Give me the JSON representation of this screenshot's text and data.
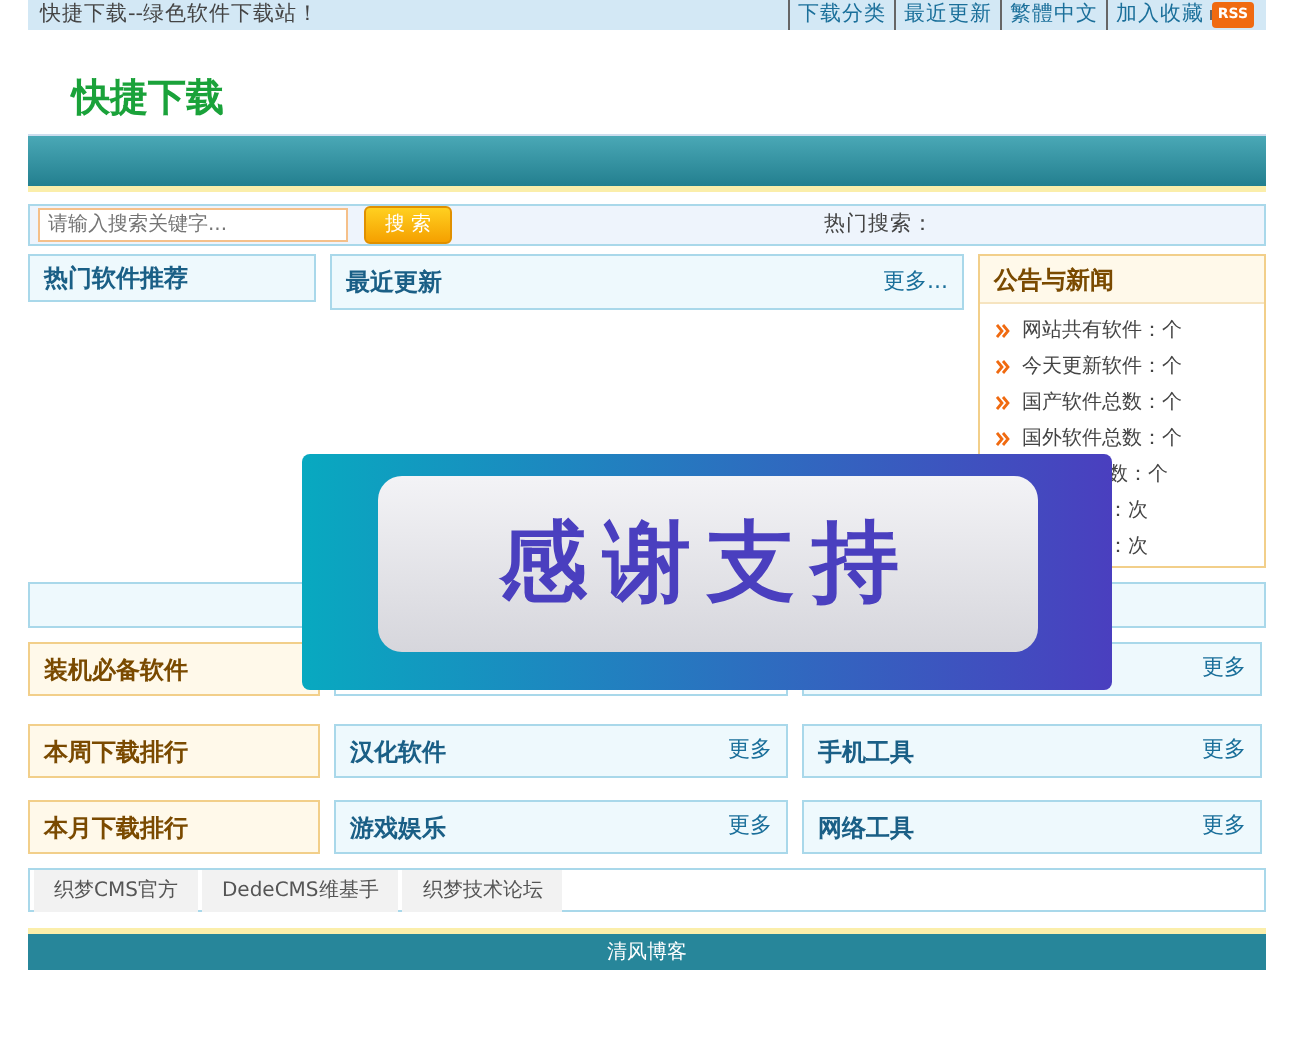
{
  "top_bar": {
    "site_slogan": "快捷下载--绿色软件下载站！",
    "links": [
      "下载分类",
      "最近更新",
      "繁體中文",
      "加入收藏"
    ],
    "rss_badge": "RSS"
  },
  "logo": "快捷下载",
  "search": {
    "placeholder": "请输入搜索关键字...",
    "button": "搜 索",
    "hot_label": "热门搜索："
  },
  "row_1": {
    "hot_panel": {
      "title": "热门软件推荐"
    },
    "recent_panel": {
      "title": "最近更新",
      "more": "更多..."
    },
    "news_panel": {
      "title": "公告与新闻",
      "items": [
        {
          "kind": "full",
          "text": "网站共有软件：个"
        },
        {
          "kind": "full",
          "text": "今天更新软件：个"
        },
        {
          "kind": "full",
          "text": "国产软件总数：个"
        },
        {
          "kind": "full",
          "text": "国外软件总数：个"
        },
        {
          "kind": "clipped",
          "text": "数：个"
        },
        {
          "kind": "clipped",
          "text": "：次"
        },
        {
          "kind": "clipped",
          "text": "：次"
        }
      ]
    }
  },
  "category_rows": [
    {
      "rank_title": "装机必备软件",
      "panels": [
        {
          "kind": "blank"
        },
        {
          "kind": "titled",
          "more": "更多"
        }
      ]
    },
    {
      "rank_title": "本周下载排行",
      "panels": [
        {
          "kind": "titled",
          "title": "汉化软件",
          "more": "更多"
        },
        {
          "kind": "titled",
          "title": "手机工具",
          "more": "更多"
        }
      ]
    },
    {
      "rank_title": "本月下载排行",
      "panels": [
        {
          "kind": "titled",
          "title": "游戏娱乐",
          "more": "更多"
        },
        {
          "kind": "titled",
          "title": "网络工具",
          "more": "更多"
        }
      ]
    }
  ],
  "friend_links": [
    "织梦CMS官方",
    "DedeCMS维基手",
    "织梦技术论坛"
  ],
  "footer": "清风博客",
  "banner": {
    "text": "感谢支持"
  }
}
